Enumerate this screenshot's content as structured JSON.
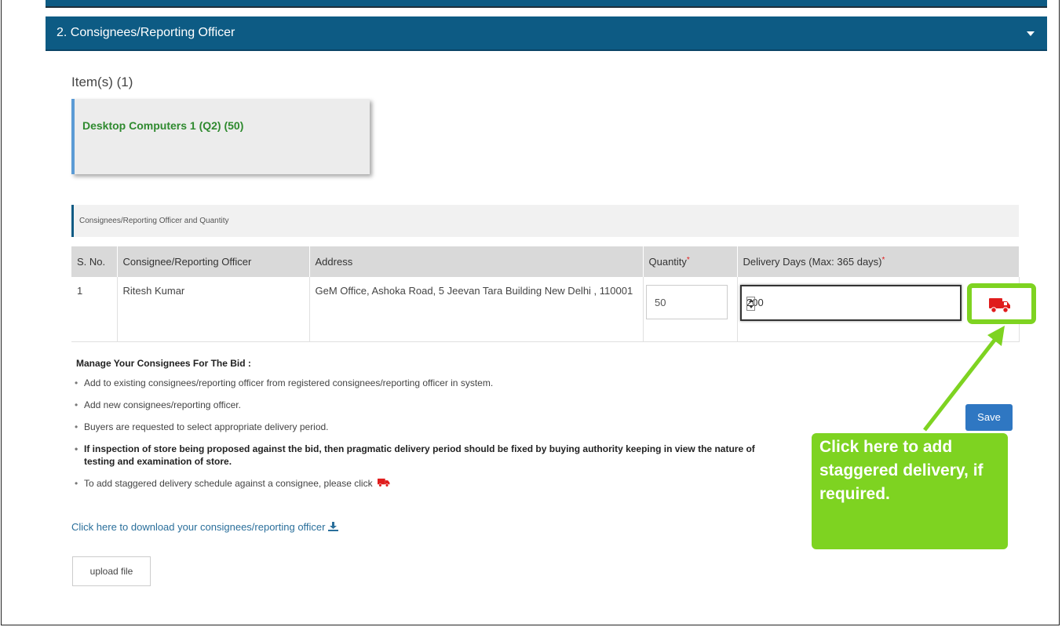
{
  "panel": {
    "title": "2. Consignees/Reporting Officer"
  },
  "items": {
    "label": "Item(s) (1)",
    "card_text": "Desktop Computers 1   (Q2)   (50)"
  },
  "section": {
    "title": "Consignees/Reporting Officer and Quantity"
  },
  "table": {
    "headers": {
      "sno": "S. No.",
      "consignee": "Consignee/Reporting Officer",
      "address": "Address",
      "quantity": "Quantity",
      "delivery": "Delivery Days (Max: 365 days)",
      "required_mark": "*"
    },
    "rows": [
      {
        "sno": "1",
        "consignee": "Ritesh Kumar",
        "address": "GeM Office, Ashoka Road, 5 Jeevan Tara Building New Delhi , 110001",
        "quantity": "50",
        "delivery_days": "200"
      }
    ]
  },
  "instructions": {
    "title": "Manage Your Consignees For The Bid :",
    "bullets": [
      "Add to existing consignees/reporting officer from registered consignees/reporting officer in system.",
      "Add new consignees/reporting officer.",
      "Buyers are requested to select appropriate delivery period.",
      "If inspection of store being proposed against the bid, then pragmatic delivery period should be fixed by buying authority keeping in view the nature of testing and examination of store.",
      "To add staggered delivery schedule against a consignee, please click"
    ]
  },
  "download_link": "Click here to download your consignees/reporting officer",
  "buttons": {
    "upload": "upload file",
    "save": "Save"
  },
  "callout": {
    "text": "Click here to add staggered delivery, if required."
  },
  "colors": {
    "header": "#0d5b84",
    "callout": "#7ed321",
    "truck": "#e01d1d",
    "item_text": "#2f8a2f"
  },
  "icons": [
    "truck-icon",
    "download-icon",
    "caret-down-icon"
  ]
}
